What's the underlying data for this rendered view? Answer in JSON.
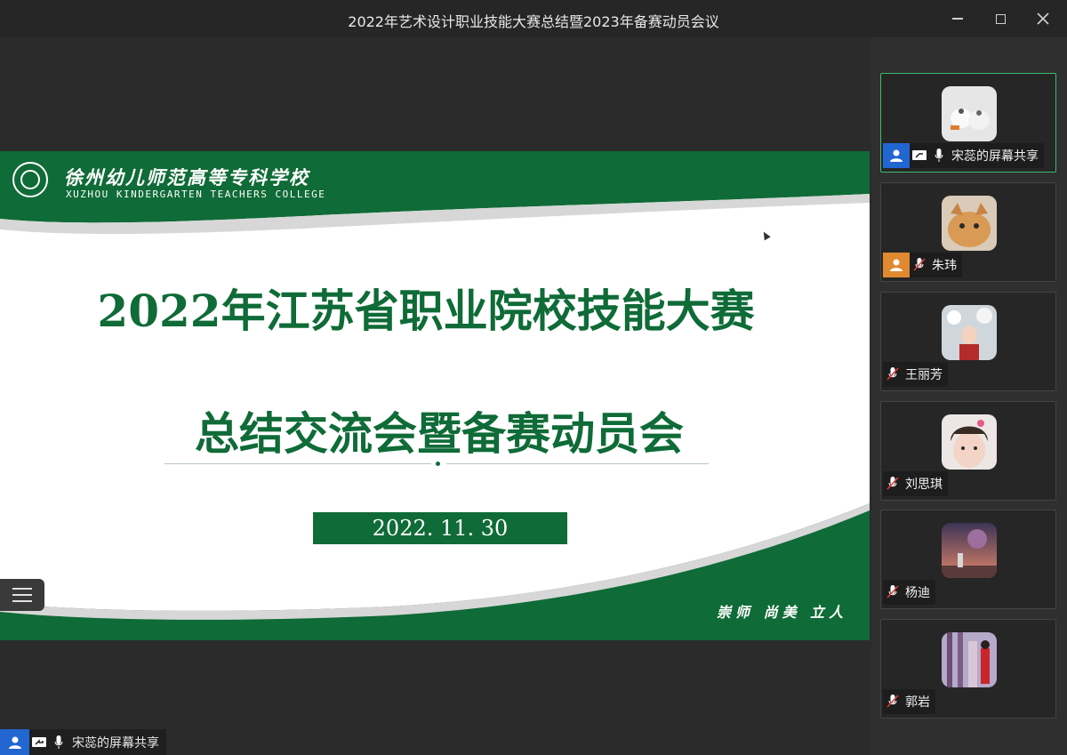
{
  "window": {
    "title": "2022年艺术设计职业技能大赛总结暨2023年备赛动员会议"
  },
  "slide": {
    "school_name_cn": "徐州幼儿师范高等专科学校",
    "school_name_en": "XUZHOU KINDERGARTEN TEACHERS COLLEGE",
    "headline_line1": "2022年江苏省职业院校技能大赛",
    "headline_line2": "总结交流会暨备赛动员会",
    "date": "2022. 11. 30",
    "motto": "崇师 尚美 立人",
    "colors": {
      "brand_green": "#0f6b37",
      "background": "#ffffff"
    }
  },
  "share_indicator": {
    "label": "宋蕊的屏幕共享"
  },
  "participants": [
    {
      "name": "宋蕊的屏幕共享",
      "role_color": "#2166d1",
      "sharing": true,
      "muted": false,
      "active": true
    },
    {
      "name": "朱玮",
      "role_color": "#e0892f",
      "sharing": false,
      "muted": true,
      "active": false
    },
    {
      "name": "王丽芳",
      "role_color": "",
      "sharing": false,
      "muted": true,
      "active": false
    },
    {
      "name": "刘思琪",
      "role_color": "",
      "sharing": false,
      "muted": true,
      "active": false
    },
    {
      "name": "杨迪",
      "role_color": "",
      "sharing": false,
      "muted": true,
      "active": false
    },
    {
      "name": "郭岩",
      "role_color": "",
      "sharing": false,
      "muted": true,
      "active": false
    }
  ],
  "icons": {
    "user": "user-icon",
    "share": "screen-share-icon",
    "mic": "microphone-icon",
    "mic_muted": "microphone-muted-icon",
    "menu": "list-menu-icon"
  }
}
